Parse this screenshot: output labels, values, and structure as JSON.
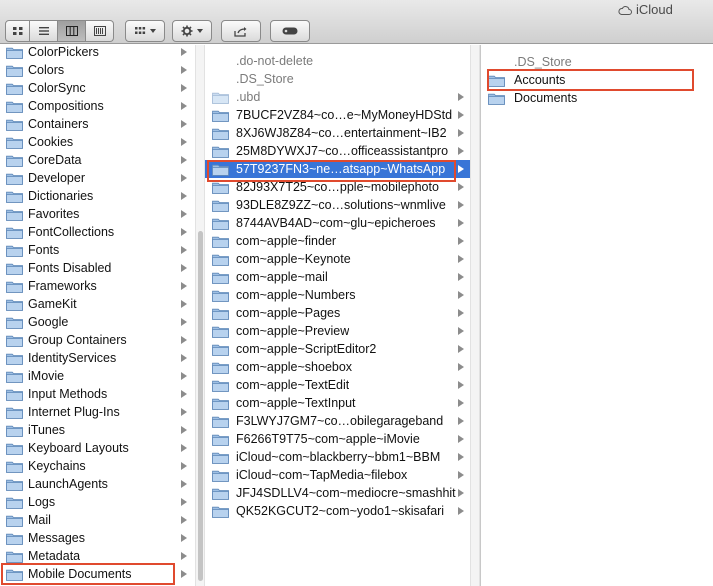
{
  "window": {
    "title": "iCloud"
  },
  "toolbar": {
    "view_icon": "icon-view-icon",
    "view_list": "list-view-icon",
    "view_columns": "column-view-icon",
    "view_coverflow": "cover-flow-icon",
    "arrange": "arrange-grid-icon",
    "action": "gear-icon",
    "share": "share-icon",
    "tags": "tag-icon"
  },
  "column1": {
    "items": [
      {
        "label": "ColorPickers"
      },
      {
        "label": "Colors"
      },
      {
        "label": "ColorSync"
      },
      {
        "label": "Compositions"
      },
      {
        "label": "Containers"
      },
      {
        "label": "Cookies"
      },
      {
        "label": "CoreData"
      },
      {
        "label": "Developer"
      },
      {
        "label": "Dictionaries"
      },
      {
        "label": "Favorites"
      },
      {
        "label": "FontCollections"
      },
      {
        "label": "Fonts"
      },
      {
        "label": "Fonts Disabled"
      },
      {
        "label": "Frameworks"
      },
      {
        "label": "GameKit"
      },
      {
        "label": "Google"
      },
      {
        "label": "Group Containers"
      },
      {
        "label": "IdentityServices"
      },
      {
        "label": "iMovie"
      },
      {
        "label": "Input Methods"
      },
      {
        "label": "Internet Plug-Ins"
      },
      {
        "label": "iTunes"
      },
      {
        "label": "Keyboard Layouts"
      },
      {
        "label": "Keychains"
      },
      {
        "label": "LaunchAgents"
      },
      {
        "label": "Logs"
      },
      {
        "label": "Mail"
      },
      {
        "label": "Messages"
      },
      {
        "label": "Metadata"
      },
      {
        "label": "Mobile Documents"
      }
    ]
  },
  "column2": {
    "items": [
      {
        "label": ".do-not-delete"
      },
      {
        "label": ".DS_Store"
      },
      {
        "label": ".ubd"
      },
      {
        "label": "7BUCF2VZ84~co…e~MyMoneyHDStd"
      },
      {
        "label": "8XJ6WJ8Z84~co…entertainment~IB2"
      },
      {
        "label": "25M8DYWXJ7~co…officeassistantpro"
      },
      {
        "label": "57T9237FN3~ne…atsapp~WhatsApp"
      },
      {
        "label": "82J93X7T25~co…pple~mobilephoto"
      },
      {
        "label": "93DLE8Z9ZZ~co…solutions~wnmlive"
      },
      {
        "label": "8744AVB4AD~com~glu~epicheroes"
      },
      {
        "label": "com~apple~finder"
      },
      {
        "label": "com~apple~Keynote"
      },
      {
        "label": "com~apple~mail"
      },
      {
        "label": "com~apple~Numbers"
      },
      {
        "label": "com~apple~Pages"
      },
      {
        "label": "com~apple~Preview"
      },
      {
        "label": "com~apple~ScriptEditor2"
      },
      {
        "label": "com~apple~shoebox"
      },
      {
        "label": "com~apple~TextEdit"
      },
      {
        "label": "com~apple~TextInput"
      },
      {
        "label": "F3LWYJ7GM7~co…obilegarageband"
      },
      {
        "label": "F6266T9T75~com~apple~iMovie"
      },
      {
        "label": "iCloud~com~blackberry~bbm1~BBM"
      },
      {
        "label": "iCloud~com~TapMedia~filebox"
      },
      {
        "label": "JFJ4SDLLV4~com~mediocre~smashhit"
      },
      {
        "label": "QK52KGCUT2~com~yodo1~skisafari"
      }
    ]
  },
  "column3": {
    "items": [
      {
        "label": ".DS_Store"
      },
      {
        "label": "Accounts"
      },
      {
        "label": "Documents"
      }
    ]
  },
  "colors": {
    "selection": "#3875d7",
    "highlight_box": "#e04a2e",
    "folder_fill": "#8fb4dc"
  }
}
